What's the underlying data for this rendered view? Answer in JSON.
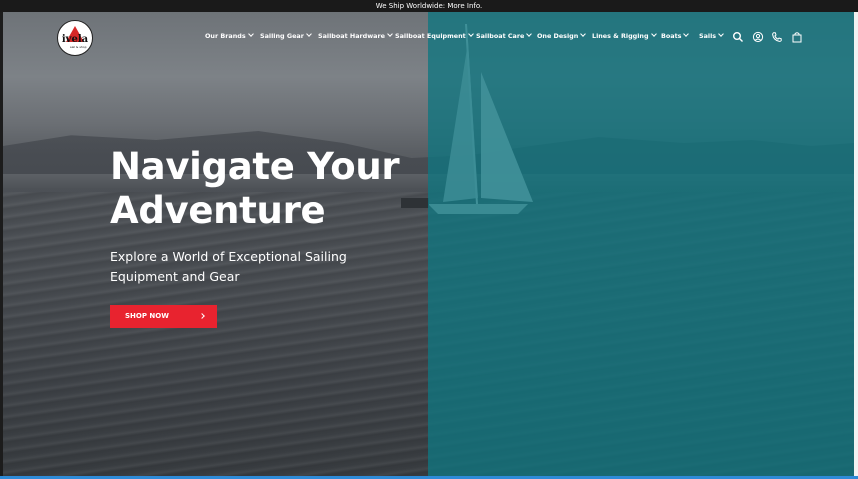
{
  "announcement": "We Ship Worldwide: More Info.",
  "logo": {
    "text": "ivela",
    "subtext": "sail & shop"
  },
  "nav": [
    "Our Brands",
    "Sailing Gear",
    "Sailboat Hardware",
    "Sailboat Equipment",
    "Sailboat Care",
    "One Design",
    "Lines & Rigging",
    "Boats",
    "Sails"
  ],
  "header_icons": [
    "search-icon",
    "account-icon",
    "phone-icon",
    "cart-icon"
  ],
  "hero": {
    "title": "Navigate Your Adventure",
    "subtitle": "Explore a World of Exceptional Sailing Equipment and Gear",
    "cta": "SHOP NOW"
  },
  "colors": {
    "accent": "#e8232f",
    "overlay": "#107680",
    "announcement_bg": "#1a1a1a"
  }
}
